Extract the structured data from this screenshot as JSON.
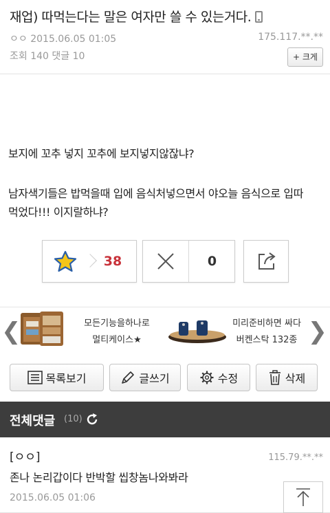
{
  "post": {
    "title": "재업) 따먹는다는 말은 여자만 쓸 수 있는거다.",
    "author": "ㅇㅇ",
    "date": "2015.06.05 01:05",
    "ip": "175.117.**.**",
    "stats": "조회 140 댓글 10",
    "zoom_label": "+ 크게",
    "body_line1": "보지에 꼬추 넣지 꼬추에 보지넣지않잖냐?",
    "body_line2a": "남자색기들은 밥먹을때 입에 음식처넣으면서 야오늘 음식으로 입따",
    "body_line2b": "먹었다!!! 이지랄하냐?"
  },
  "votes": {
    "like_count": "38",
    "dislike_count": "0"
  },
  "ad": {
    "item1_line1": "모든기능을하나로",
    "item1_line2": "멀티케이스★",
    "item2_line1": "미리준비하면 싸다",
    "item2_line2": "버켄스탁 132종"
  },
  "buttons": {
    "list": "목록보기",
    "write": "글쓰기",
    "edit": "수정",
    "delete": "삭제"
  },
  "comments": {
    "header_title": "전체댓글",
    "header_count": "(10)",
    "items": [
      {
        "author": "[ㅇㅇ]",
        "ip": "115.79.**.**",
        "text": "존나 논리갑이다 반박할 씹창놈나와봐라",
        "date": "2015.06.05 01:06"
      }
    ]
  },
  "colors": {
    "like_count": "#c8323a",
    "comment_header_bg": "#3d3d3d",
    "star_fill": "#f5c518",
    "star_stroke": "#2a5fa8"
  }
}
